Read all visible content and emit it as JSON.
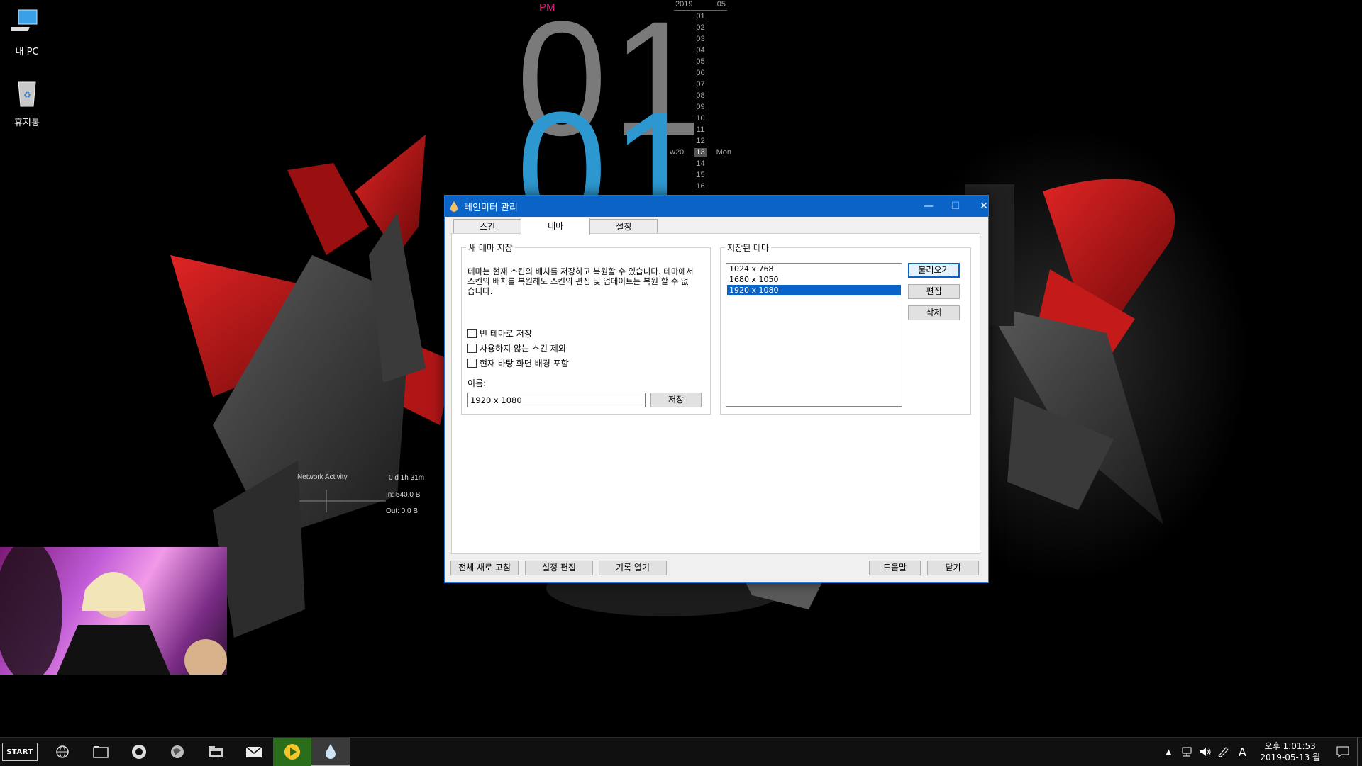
{
  "desktop": {
    "icons": [
      {
        "label": "내 PC",
        "icon": "computer-icon"
      },
      {
        "label": "휴지통",
        "icon": "recycle-bin-icon"
      }
    ]
  },
  "clock": {
    "ampm": "PM",
    "hour": "01",
    "hour_overlay": "01",
    "colors": {
      "ampm": "#e0197a",
      "primary": "#7a7a7a",
      "overlay": "#2d97cf"
    }
  },
  "calendar": {
    "year": "2019",
    "month": "05",
    "days": [
      "01",
      "02",
      "03",
      "04",
      "05",
      "06",
      "07",
      "08",
      "09",
      "10",
      "11",
      "12",
      "13",
      "14",
      "15",
      "16"
    ],
    "week_label": "w20",
    "today": "13",
    "today_dow": "Mon"
  },
  "network": {
    "title": "Network Activity",
    "uptime": "0 d 1h 31m",
    "in": "In: 540.0 B",
    "out": "Out: 0.0 B"
  },
  "dialog": {
    "title": "레인미터 관리",
    "tabs": [
      "스킨",
      "테마",
      "설정"
    ],
    "active_tab": "테마",
    "new_theme": {
      "legend": "새 테마 저장",
      "description": "테마는 현재 스킨의 배치를 저장하고 복원할 수 있습니다. 테마에서 스킨의 배치를 복원해도 스킨의 편집 및 업데이트는 복원 할 수 없습니다.",
      "options": [
        "빈 테마로 저장",
        "사용하지 않는 스킨 제외",
        "현재 바탕 화면 배경 포함"
      ],
      "name_label": "이름:",
      "name_value": "1920 x 1080",
      "save_button": "저장"
    },
    "saved_themes": {
      "legend": "저장된 테마",
      "items": [
        "1024 x 768",
        "1680 x 1050",
        "1920 x 1080"
      ],
      "selected": "1920 x 1080",
      "load_button": "불러오기",
      "edit_button": "편집",
      "delete_button": "삭제"
    },
    "footer": {
      "refresh_all": "전체 새로 고침",
      "edit_settings": "설정 편집",
      "open_log": "기록 열기",
      "help": "도움말",
      "close": "닫기"
    }
  },
  "taskbar": {
    "start_label": "START",
    "apps": [
      "globe-icon",
      "folder-icon",
      "media-icon",
      "browser-icon",
      "explorer-icon",
      "mail-icon",
      "player-icon",
      "rainmeter-icon"
    ],
    "ime": "A",
    "time": "오후 1:01:53",
    "date": "2019-05-13 월"
  },
  "colors": {
    "accent": "#0a64c8",
    "wallpaper_red": "#c41a1a"
  }
}
